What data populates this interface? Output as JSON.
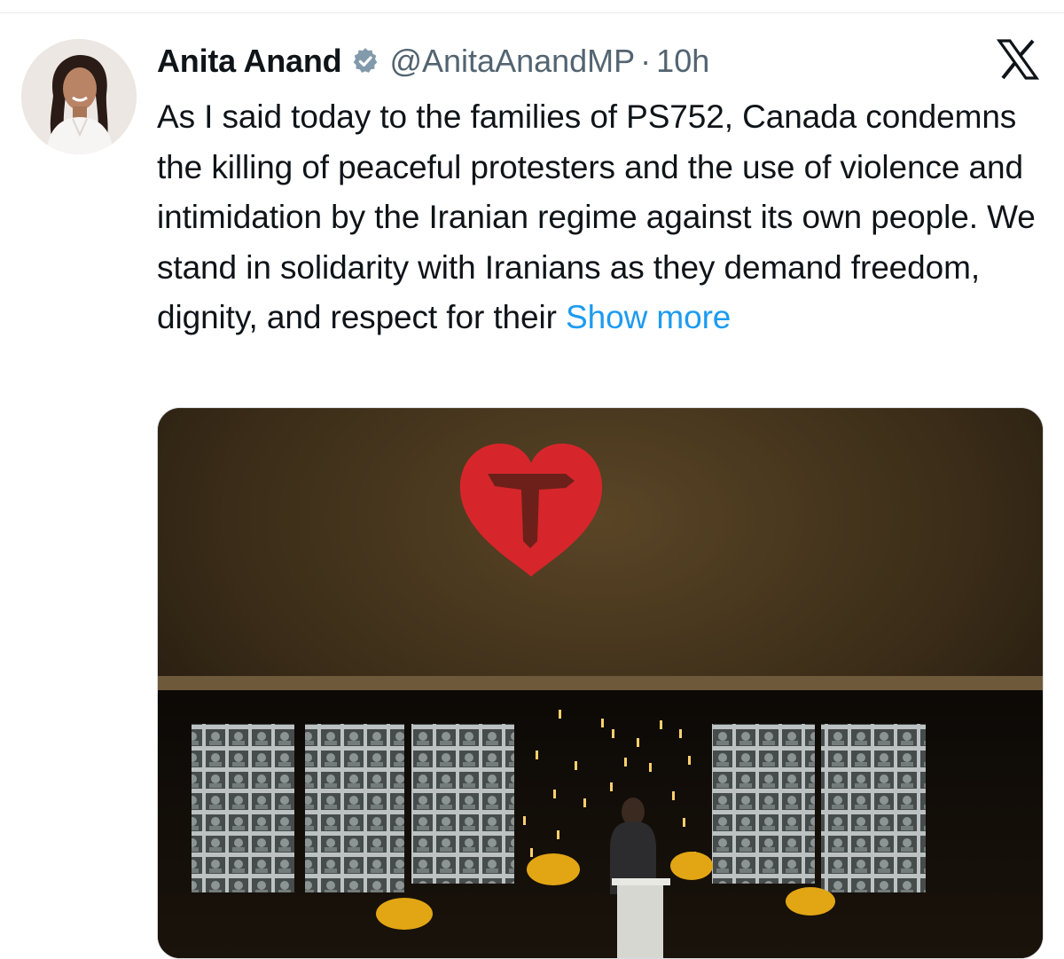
{
  "tweet": {
    "author_name": "Anita Anand",
    "handle": "@AnitaAnandMP",
    "separator": "·",
    "time": "10h",
    "text": "As I said today to the families of PS752, Canada condemns the killing of peaceful protesters and the use of violence and intimidation by the Iranian regime against its own people. We stand in solidarity with Iranians as they demand freedom, dignity, and respect for their",
    "show_more_label": "Show more"
  },
  "icons": {
    "verified": "verified-badge-icon",
    "platform": "x-logo-icon"
  },
  "colors": {
    "link": "#1d9bf0",
    "secondary_text": "#536471",
    "primary_text": "#0f1419",
    "heart": "#d6262b",
    "candle": "#ffcf6b"
  }
}
